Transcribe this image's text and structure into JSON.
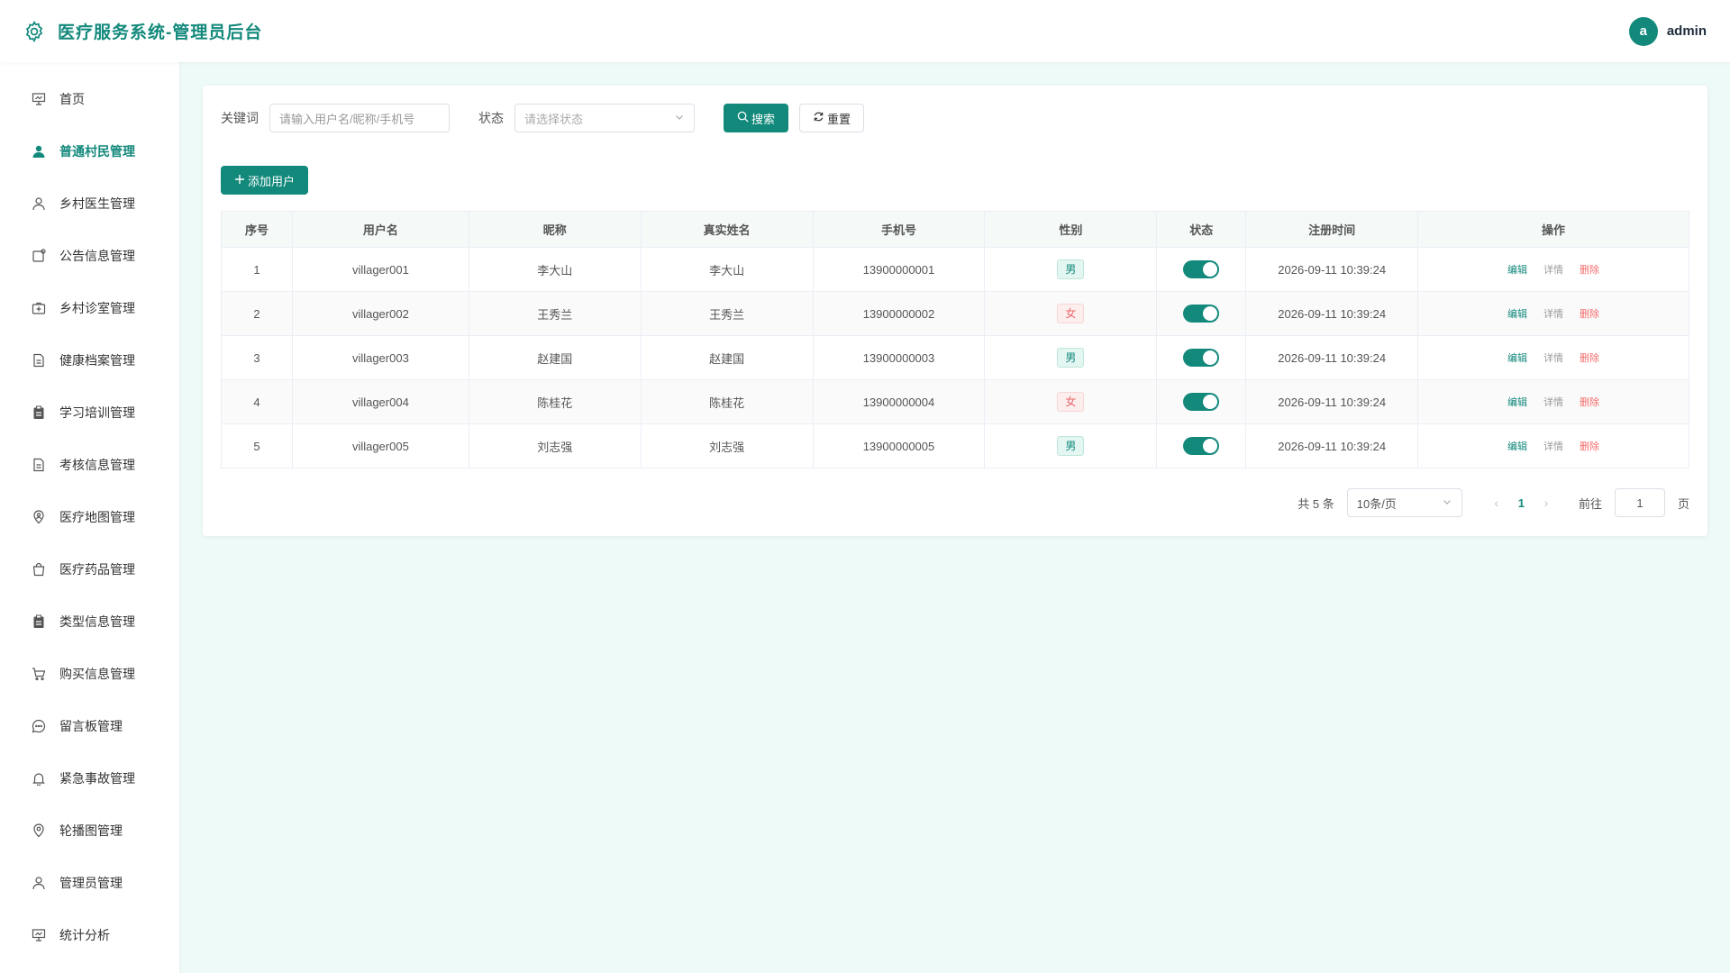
{
  "header": {
    "title": "医疗服务系统-管理员后台",
    "avatar_letter": "a",
    "username": "admin",
    "brand_icon": "gear-icon"
  },
  "colors": {
    "primary": "#13897c",
    "danger": "#f56c6c",
    "background": "#eefaf8"
  },
  "sidebar": {
    "items": [
      {
        "label": "首页",
        "icon": "presentation-icon"
      },
      {
        "label": "普通村民管理",
        "icon": "user-filled-icon",
        "active": true
      },
      {
        "label": "乡村医生管理",
        "icon": "user-icon"
      },
      {
        "label": "公告信息管理",
        "icon": "notice-icon"
      },
      {
        "label": "乡村诊室管理",
        "icon": "first-aid-kit-icon"
      },
      {
        "label": "健康档案管理",
        "icon": "document-icon"
      },
      {
        "label": "学习培训管理",
        "icon": "clipboard-icon"
      },
      {
        "label": "考核信息管理",
        "icon": "document-icon"
      },
      {
        "label": "医疗地图管理",
        "icon": "location-person-icon"
      },
      {
        "label": "医疗药品管理",
        "icon": "shopping-bag-icon"
      },
      {
        "label": "类型信息管理",
        "icon": "clipboard-icon"
      },
      {
        "label": "购买信息管理",
        "icon": "shopping-cart-icon"
      },
      {
        "label": "留言板管理",
        "icon": "chat-icon"
      },
      {
        "label": "紧急事故管理",
        "icon": "bell-icon"
      },
      {
        "label": "轮播图管理",
        "icon": "location-pin-icon"
      },
      {
        "label": "管理员管理",
        "icon": "user-icon"
      },
      {
        "label": "统计分析",
        "icon": "presentation-icon"
      }
    ]
  },
  "search": {
    "keyword_label": "关键词",
    "keyword_placeholder": "请输入用户名/昵称/手机号",
    "status_label": "状态",
    "status_placeholder": "请选择状态",
    "search_btn": "搜索",
    "reset_btn": "重置"
  },
  "add_btn": "添加用户",
  "table": {
    "headers": [
      "序号",
      "用户名",
      "昵称",
      "真实姓名",
      "手机号",
      "性别",
      "状态",
      "注册时间",
      "操作"
    ],
    "rows": [
      {
        "index": "1",
        "username": "villager001",
        "nickname": "李大山",
        "realname": "李大山",
        "phone": "13900000001",
        "gender": "男",
        "status_on": true,
        "created": "2026-09-11 10:39:24"
      },
      {
        "index": "2",
        "username": "villager002",
        "nickname": "王秀兰",
        "realname": "王秀兰",
        "phone": "13900000002",
        "gender": "女",
        "status_on": true,
        "created": "2026-09-11 10:39:24"
      },
      {
        "index": "3",
        "username": "villager003",
        "nickname": "赵建国",
        "realname": "赵建国",
        "phone": "13900000003",
        "gender": "男",
        "status_on": true,
        "created": "2026-09-11 10:39:24"
      },
      {
        "index": "4",
        "username": "villager004",
        "nickname": "陈桂花",
        "realname": "陈桂花",
        "phone": "13900000004",
        "gender": "女",
        "status_on": true,
        "created": "2026-09-11 10:39:24"
      },
      {
        "index": "5",
        "username": "villager005",
        "nickname": "刘志强",
        "realname": "刘志强",
        "phone": "13900000005",
        "gender": "男",
        "status_on": true,
        "created": "2026-09-11 10:39:24"
      }
    ],
    "ops": {
      "edit": "编辑",
      "detail": "详情",
      "delete": "删除"
    }
  },
  "pagination": {
    "total_text": "共 5 条",
    "page_size": "10条/页",
    "current_page": "1",
    "goto_label": "前往",
    "goto_value": "1",
    "page_unit": "页"
  }
}
